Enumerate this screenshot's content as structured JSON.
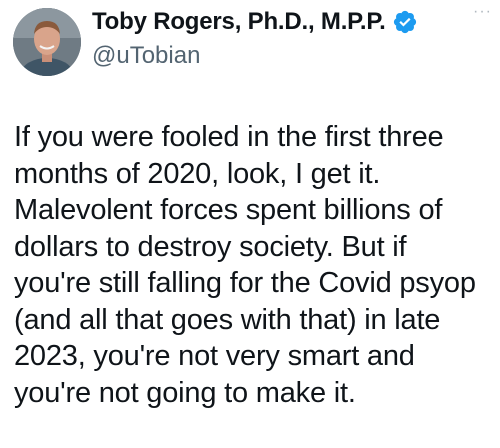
{
  "author": {
    "display_name": "Toby Rogers, Ph.D., M.P.P.",
    "handle": "@uTobian",
    "avatar_icon": "profile-photo",
    "verified_icon": "verified-badge-icon",
    "verified_color": "#1d9bf0"
  },
  "menu": {
    "more_label": "···",
    "icon": "more-options-icon"
  },
  "tweet": {
    "text": "If you were fooled in the first three\nmonths of 2020, look, I get it.\nMalevolent forces spent billions of\ndollars to destroy society. But if\nyou're still falling for the Covid psyop\n(and all that goes with that) in late\n2023, you're not very smart and\nyou're not going to make it."
  },
  "colors": {
    "text": "#0f1419",
    "secondary": "#536471",
    "accent": "#1d9bf0",
    "background": "#ffffff"
  }
}
